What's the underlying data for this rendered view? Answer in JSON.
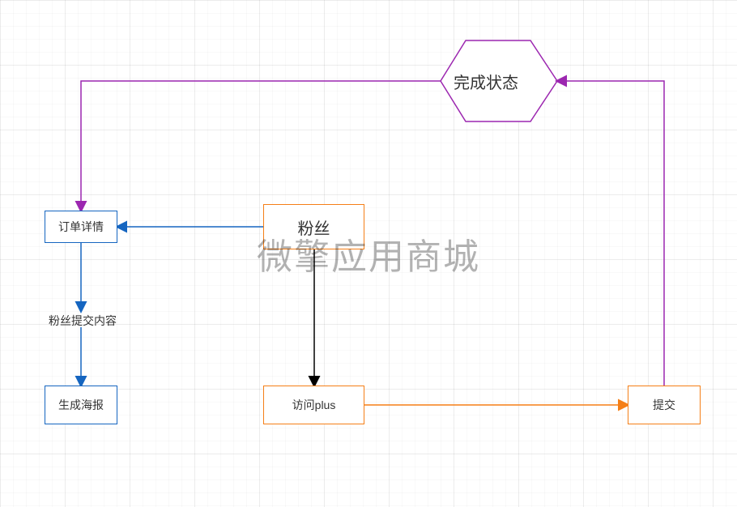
{
  "watermark": "微擎应用商城",
  "nodes": {
    "complete_status": "完成状态",
    "order_details": "订单详情",
    "fans_submit_content": "粉丝提交内容",
    "generate_poster": "生成海报",
    "fans": "粉丝",
    "visit_plus": "访问plus",
    "submit": "提交"
  }
}
